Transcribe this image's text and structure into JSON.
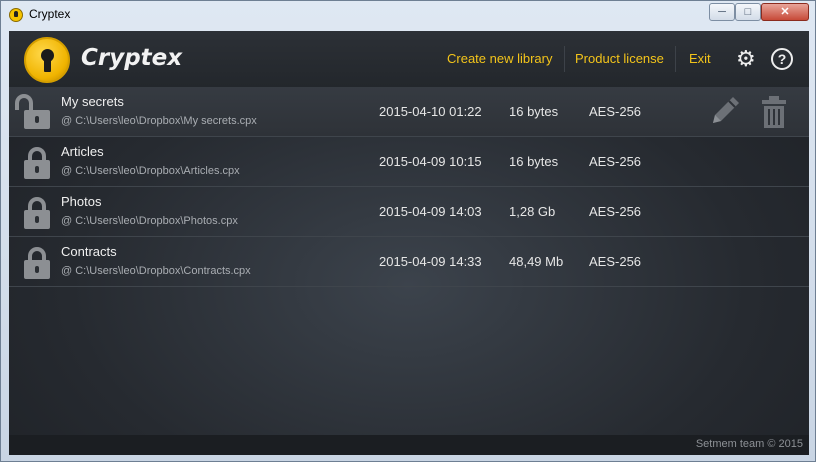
{
  "window": {
    "title": "Cryptex",
    "buttons": {
      "minimize": "─",
      "maximize": "□",
      "close": "✕"
    }
  },
  "header": {
    "brand": "Cryptex",
    "nav": [
      "Create new library",
      "Product license",
      "Exit"
    ],
    "icons": [
      "gear-icon",
      "help-icon"
    ],
    "accent_color": "#f3c41a"
  },
  "libraries": [
    {
      "name": "My secrets",
      "path": "@ C:\\Users\\leo\\Dropbox\\My secrets.cpx",
      "date": "2015-04-10 01:22",
      "size": "16 bytes",
      "cipher": "AES-256",
      "state": "unlocked",
      "selected": true
    },
    {
      "name": "Articles",
      "path": "@ C:\\Users\\leo\\Dropbox\\Articles.cpx",
      "date": "2015-04-09 10:15",
      "size": "16 bytes",
      "cipher": "AES-256",
      "state": "locked"
    },
    {
      "name": "Photos",
      "path": "@ C:\\Users\\leo\\Dropbox\\Photos.cpx",
      "date": "2015-04-09 14:03",
      "size": "1,28 Gb",
      "cipher": "AES-256",
      "state": "locked"
    },
    {
      "name": "Contracts",
      "path": "@ C:\\Users\\leo\\Dropbox\\Contracts.cpx",
      "date": "2015-04-09 14:33",
      "size": "48,49 Mb",
      "cipher": "AES-256",
      "state": "locked"
    }
  ],
  "footer": {
    "text": "Setmem team © 2015"
  }
}
